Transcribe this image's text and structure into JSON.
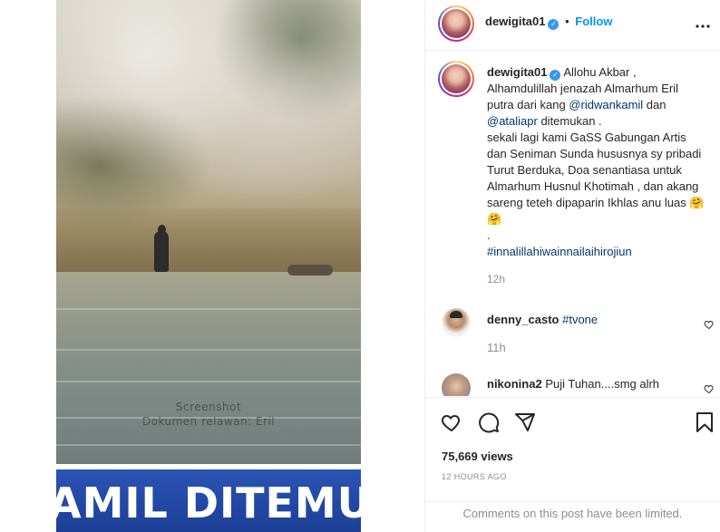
{
  "video": {
    "overlay_line1": "Screenshot",
    "overlay_line2": "Dokumen relawan: Eril",
    "banner_text": "AMIL DITEMUKAN"
  },
  "post": {
    "username": "dewigita01",
    "verified": true,
    "follow_label": "Follow",
    "more_label": "•••",
    "caption": {
      "author": "dewigita01",
      "line1_text": "Allohu Akbar ,",
      "line2_text": "Alhamdulillah jenazah Almarhum Eril putra dari kang ",
      "mention1": "@ridwankamil",
      "after_mention1": " dan ",
      "mention2": "@ataliapr",
      "after_mention2": " ditemukan .",
      "body": "sekali lagi kami GaSS Gabungan Artis dan Seniman Sunda hususnya sy pribadi Turut Berduka, Doa senantiasa untuk Almarhum Husnul Khotimah , dan akang sareng teteh dipaparin Ikhlas anu luas",
      "emojis": "🤗 🤗",
      "dot": ".",
      "hashtag": "#innalillahiwainnailaihirojiun",
      "time": "12h"
    },
    "comments": [
      {
        "username": "denny_casto",
        "text": "#tvone",
        "time": "11h"
      },
      {
        "username": "nikonina2",
        "text": "Puji Tuhan....smg alrh",
        "time": ""
      }
    ],
    "views": "75,669 views",
    "timestamp": "12 HOURS AGO",
    "comments_limited": "Comments on this post have been limited."
  },
  "colors": {
    "link_blue": "#0095f6",
    "mention_blue": "#00376b",
    "verified_blue": "#3897f0",
    "banner_blue": "#1d3f96"
  },
  "icons": [
    "heart-icon",
    "comment-icon",
    "share-icon",
    "bookmark-icon",
    "more-options-icon",
    "verified-icon"
  ]
}
